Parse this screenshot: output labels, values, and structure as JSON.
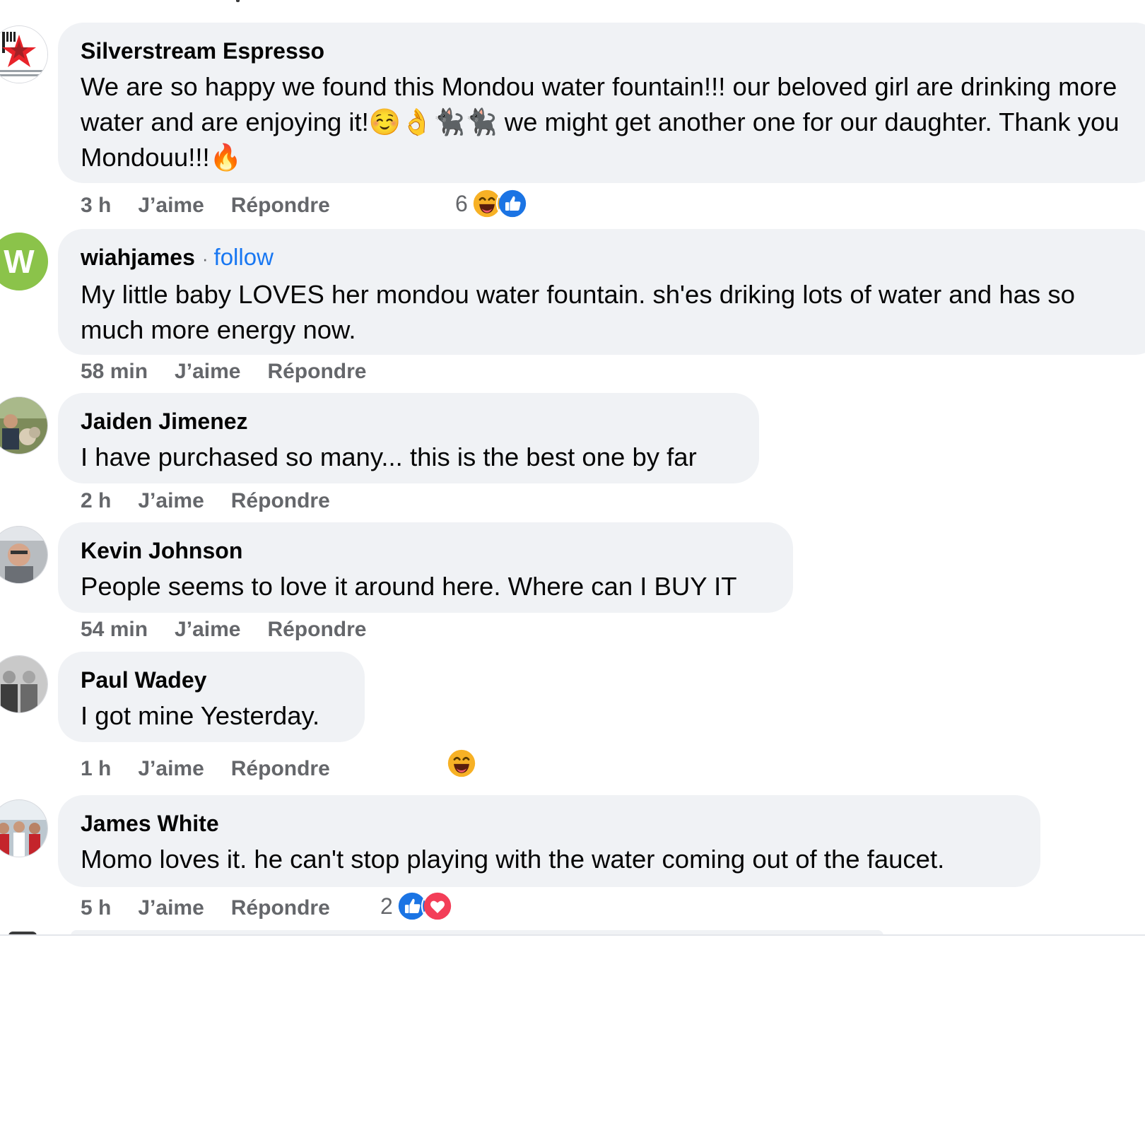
{
  "comments": [
    {
      "author": "Silverstream Espresso",
      "text": "We are so happy we found this Mondou water fountain!!! our beloved girl are drinking more water and are enjoying it!☺️👌🐈‍⬛🐈‍⬛ we might get another one for our daughter. Thank you Mondouu!!!🔥",
      "time": "3 h",
      "like_label": "J’aime",
      "reply_label": "Répondre",
      "reaction_count": "6",
      "reactions": [
        "haha-icon",
        "like-icon"
      ]
    },
    {
      "author": "wiahjames",
      "separator": "·",
      "follow_label": "follow",
      "avatar_letter": "W",
      "text": "My little baby LOVES her mondou water fountain. sh'es driking lots of water and has so much more energy now.",
      "time": "58 min",
      "like_label": "J’aime",
      "reply_label": "Répondre"
    },
    {
      "author": "Jaiden Jimenez",
      "text": "I have purchased so many... this is the best one by far",
      "time": "2 h",
      "like_label": "J’aime",
      "reply_label": "Répondre"
    },
    {
      "author": "Kevin Johnson",
      "text": "People seems to love it around here. Where can I BUY IT",
      "time": "54 min",
      "like_label": "J’aime",
      "reply_label": "Répondre"
    },
    {
      "author": "Paul Wadey",
      "text": "I got mine Yesterday.",
      "time": "1 h",
      "like_label": "J’aime",
      "reply_label": "Répondre",
      "reactions": [
        "haha-icon"
      ]
    },
    {
      "author": "James White",
      "text": "Momo loves it. he can't stop playing with the water coming out of the faucet.",
      "time": "5 h",
      "like_label": "J’aime",
      "reply_label": "Répondre",
      "reaction_count": "2",
      "reactions": [
        "like-icon",
        "love-icon"
      ]
    }
  ],
  "colors": {
    "bubble": "#f0f2f5",
    "meta_text": "#65676b",
    "link_blue": "#1877f2",
    "like_blue": "#1b74e4",
    "love_red": "#f33e58",
    "haha_yellow": "#f7b125",
    "avatar_green": "#8bc34a"
  }
}
